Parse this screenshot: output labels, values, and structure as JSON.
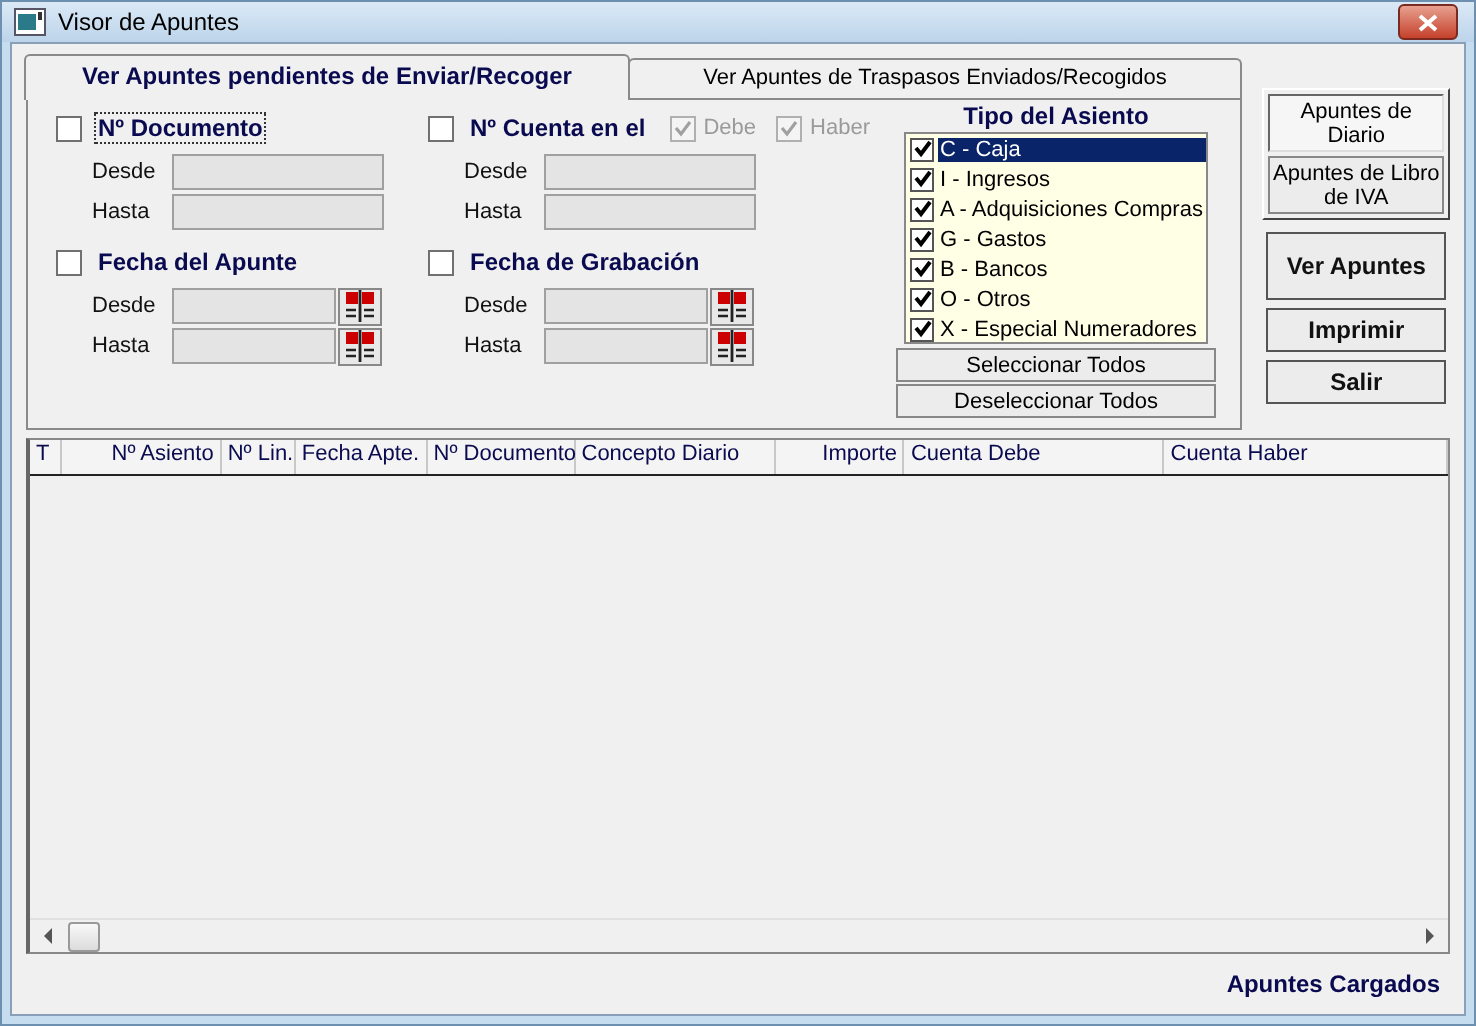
{
  "window": {
    "title": "Visor de Apuntes"
  },
  "tabs": [
    {
      "label": "Ver Apuntes pendientes de Enviar/Recoger",
      "selected": true
    },
    {
      "label": "Ver Apuntes de Traspasos Enviados/Recogidos",
      "selected": false
    }
  ],
  "filters": [
    {
      "label": "Nº Documento",
      "checked": false,
      "focused": true,
      "fields": [
        {
          "label": "Desde",
          "disabled": true,
          "calendar": false
        },
        {
          "label": "Hasta",
          "disabled": true,
          "calendar": false
        }
      ]
    },
    {
      "label": "Nº Cuenta en el",
      "checked": false,
      "focused": false,
      "options": [
        {
          "label": "Debe",
          "checked": true,
          "disabled": true
        },
        {
          "label": "Haber",
          "checked": true,
          "disabled": true
        }
      ],
      "fields": [
        {
          "label": "Desde",
          "disabled": true,
          "calendar": false
        },
        {
          "label": "Hasta",
          "disabled": true,
          "calendar": false
        }
      ]
    },
    {
      "label": "Fecha del Apunte",
      "checked": false,
      "focused": false,
      "fields": [
        {
          "label": "Desde",
          "disabled": true,
          "calendar": true
        },
        {
          "label": "Hasta",
          "disabled": true,
          "calendar": true
        }
      ]
    },
    {
      "label": "Fecha de Grabación",
      "checked": false,
      "focused": false,
      "fields": [
        {
          "label": "Desde",
          "disabled": true,
          "calendar": true
        },
        {
          "label": "Hasta",
          "disabled": true,
          "calendar": true
        }
      ]
    }
  ],
  "tipo_asiento": {
    "title": "Tipo del Asiento",
    "items": [
      {
        "label": "C - Caja",
        "checked": true,
        "selected": true
      },
      {
        "label": "I - Ingresos",
        "checked": true,
        "selected": false
      },
      {
        "label": "A - Adquisiciones Compras",
        "checked": true,
        "selected": false
      },
      {
        "label": "G - Gastos",
        "checked": true,
        "selected": false
      },
      {
        "label": "B - Bancos",
        "checked": true,
        "selected": false
      },
      {
        "label": "O - Otros",
        "checked": true,
        "selected": false
      },
      {
        "label": "X - Especial Numeradores",
        "checked": true,
        "selected": false
      }
    ],
    "buttons": [
      "Seleccionar Todos",
      "Deseleccionar Todos"
    ]
  },
  "views": [
    {
      "label": "Apuntes de Diario",
      "selected": true
    },
    {
      "label": "Apuntes de Libro de IVA",
      "selected": false
    }
  ],
  "actions": [
    "Ver Apuntes",
    "Imprimir",
    "Salir"
  ],
  "table": {
    "columns": [
      "T",
      "Nº Asiento",
      "Nº Lin.",
      "Fecha Apte.",
      "Nº Documento",
      "Concepto Diario",
      "Importe",
      "Cuenta Debe",
      "Cuenta Haber"
    ]
  },
  "status_bar": {
    "text": "Apuntes Cargados"
  }
}
